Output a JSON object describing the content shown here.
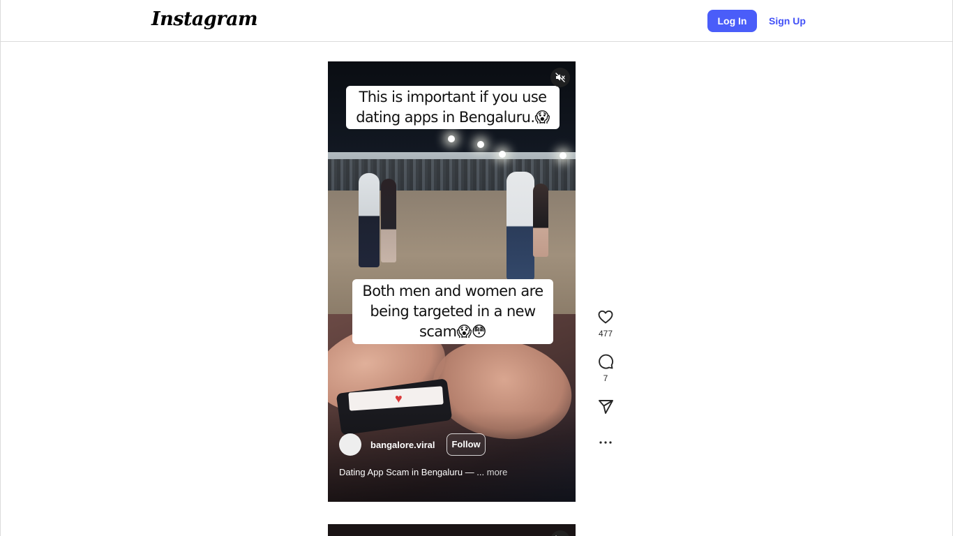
{
  "header": {
    "logo_text": "Instagram",
    "login_label": "Log In",
    "signup_label": "Sign Up"
  },
  "reel": {
    "caption_top": "This is important if you use dating apps in Bengaluru.😱",
    "caption_bottom": "Both men and women are being targeted in a new scam😱😳",
    "username": "bangalore.viral",
    "follow_label": "Follow",
    "description": "Dating App Scam in Bengaluru — ...",
    "more_label": "more"
  },
  "actions": {
    "likes": "477",
    "comments": "7"
  },
  "icons": {
    "mute": "speaker-muted-icon",
    "like": "heart-icon",
    "comment": "comment-bubble-icon",
    "share": "paper-plane-icon",
    "more": "more-horizontal-icon"
  },
  "colors": {
    "primary_button": "#4a5df9",
    "link": "#4150f7",
    "border": "#dbdbdb"
  }
}
